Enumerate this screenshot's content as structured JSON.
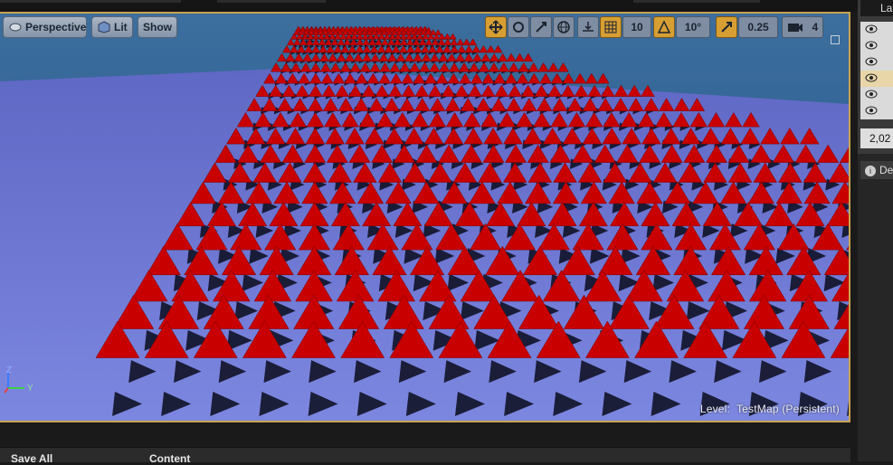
{
  "viewport": {
    "buttons": {
      "perspective": "Perspective",
      "lit": "Lit",
      "show": "Show"
    },
    "toolbar": {
      "grid_snap": "10",
      "rotation_snap": "10°",
      "scale_snap": "0.25",
      "camera_speed": "4"
    },
    "level_label": "Level:",
    "level_name": "TestMap (Persistent)",
    "axis": {
      "z": "Z",
      "y": "Y"
    },
    "colors": {
      "accent": "#d79f33",
      "floor": "#6f7bd2",
      "spikes": "#c80000"
    }
  },
  "right_panel": {
    "tab_label": "La",
    "value_text": "2,02",
    "details_label": "De"
  },
  "bottom_bar": {
    "left_label": "Save All",
    "content_label": "Content"
  }
}
